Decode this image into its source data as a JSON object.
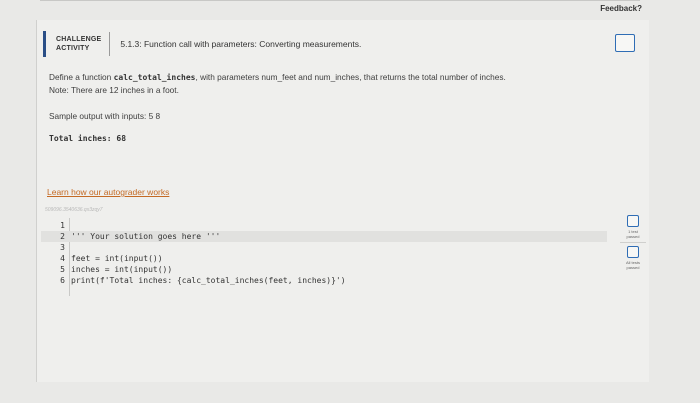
{
  "feedback_label": "Feedback?",
  "challenge": {
    "label_line1": "CHALLENGE",
    "label_line2": "ACTIVITY",
    "title": "5.1.3: Function call with parameters: Converting measurements."
  },
  "description": {
    "line1_pre": "Define a function ",
    "function_name": "calc_total_inches",
    "line1_post": ", with parameters num_feet and num_inches, that returns the total number of inches.",
    "line2": "Note: There are 12 inches in a foot."
  },
  "sample": {
    "label": "Sample output with inputs: 5 8",
    "output": "Total inches: 68"
  },
  "autograder_link": "Learn how our autograder works",
  "session_id": "509096.3540636.qx3zqy7",
  "code_lines": [
    {
      "num": "1",
      "text": ""
    },
    {
      "num": "2",
      "text": "''' Your solution goes here '''"
    },
    {
      "num": "3",
      "text": ""
    },
    {
      "num": "4",
      "text": "feet = int(input())"
    },
    {
      "num": "5",
      "text": "inches = int(input())"
    },
    {
      "num": "6",
      "text": "print(f'Total inches: {calc_total_inches(feet, inches)}')"
    }
  ],
  "tests": {
    "one_line1": "1 test",
    "one_line2": "passed",
    "all_line1": "All tests",
    "all_line2": "passed"
  }
}
